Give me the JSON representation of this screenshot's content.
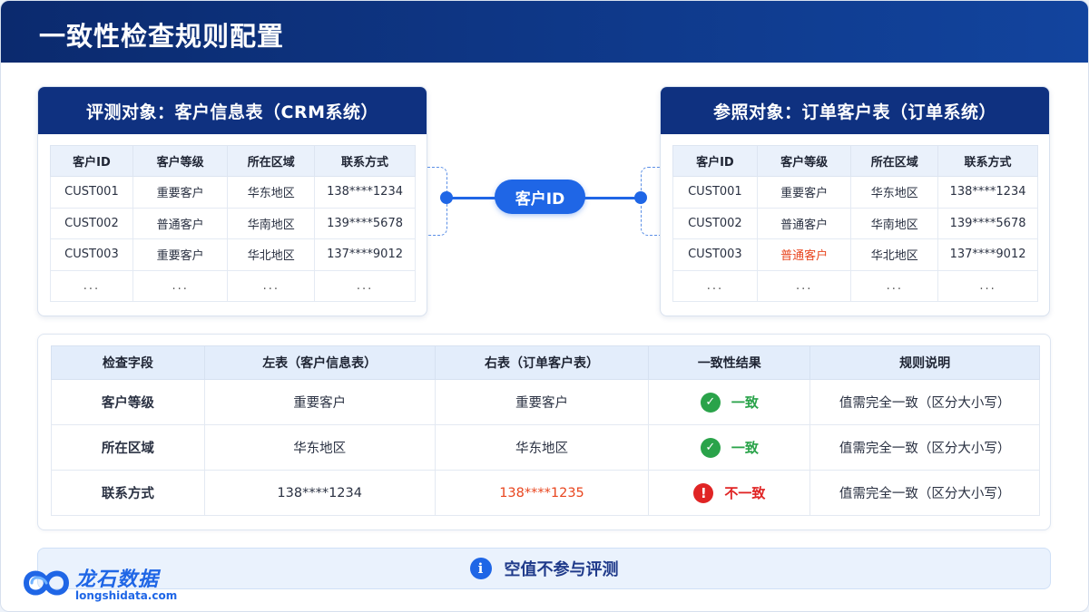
{
  "page": {
    "title": "一致性检查规则配置"
  },
  "left_card": {
    "title": "评测对象：客户信息表（CRM系统）",
    "headers": [
      "客户ID",
      "客户等级",
      "所在区域",
      "联系方式"
    ],
    "rows": [
      [
        "CUST001",
        "重要客户",
        "华东地区",
        "138****1234"
      ],
      [
        "CUST002",
        "普通客户",
        "华南地区",
        "139****5678"
      ],
      [
        "CUST003",
        "重要客户",
        "华北地区",
        "137****9012"
      ],
      [
        "...",
        "...",
        "...",
        "..."
      ]
    ]
  },
  "right_card": {
    "title": "参照对象：订单客户表（订单系统）",
    "headers": [
      "客户ID",
      "客户等级",
      "所在区域",
      "联系方式"
    ],
    "rows": [
      [
        "CUST001",
        "重要客户",
        "华东地区",
        "138****1234"
      ],
      [
        "CUST002",
        "普通客户",
        "华南地区",
        "139****5678"
      ],
      [
        "CUST003",
        "普通客户",
        "华北地区",
        "137****9012"
      ],
      [
        "...",
        "...",
        "...",
        "..."
      ]
    ]
  },
  "join_key": "客户ID",
  "check_table": {
    "headers": [
      "检查字段",
      "左表（客户信息表）",
      "右表（订单客户表）",
      "一致性结果",
      "规则说明"
    ],
    "rows": [
      {
        "field": "客户等级",
        "left": "重要客户",
        "right": "重要客户",
        "result": "一致",
        "rule": "值需完全一致（区分大小写）"
      },
      {
        "field": "所在区域",
        "left": "华东地区",
        "right": "华东地区",
        "result": "一致",
        "rule": "值需完全一致（区分大小写）"
      },
      {
        "field": "联系方式",
        "left": "138****1234",
        "right": "138****1235",
        "result": "不一致",
        "rule": "值需完全一致（区分大小写）"
      }
    ]
  },
  "note": {
    "text": "空值不参与评测"
  },
  "logo": {
    "name": "龙石数据",
    "url": "longshidata.com"
  },
  "colors": {
    "navy": "#0f3180",
    "accent": "#1f66e6",
    "ok": "#2aa34a",
    "bad": "#e02424",
    "mismatch_text": "#e8451e"
  }
}
